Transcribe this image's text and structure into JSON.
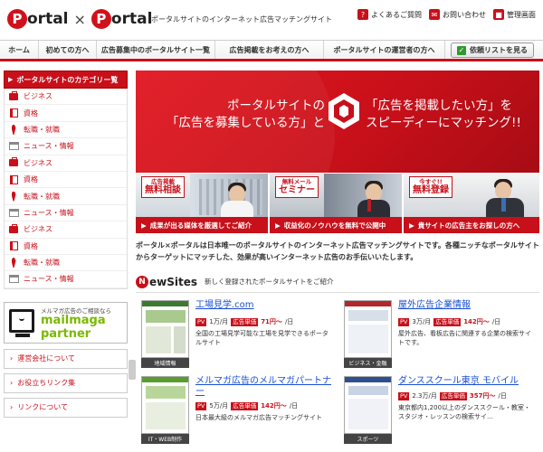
{
  "header": {
    "logo_left": "ortal",
    "logo_x": "×",
    "logo_right": "ortal",
    "logo_letter": "P",
    "tagline": "ポータルサイトのインターネット広告マッチングサイト",
    "links": [
      {
        "icon": "question-icon",
        "label": "よくあるご質問"
      },
      {
        "icon": "mail-icon",
        "label": "お問い合わせ"
      },
      {
        "icon": "lock-icon",
        "label": "管理画面"
      }
    ]
  },
  "nav": {
    "items": [
      "ホーム",
      "初めての方へ",
      "広告募集中のポータルサイト一覧",
      "広告掲載をお考えの方へ",
      "ポータルサイトの運営者の方へ"
    ],
    "list_button": "依頼リストを見る"
  },
  "sidebar": {
    "category_title": "ポータルサイトのカテゴリー覧",
    "categories": [
      {
        "icon": "briefcase-icon",
        "label": "ビジネス"
      },
      {
        "icon": "book-icon",
        "label": "資格"
      },
      {
        "icon": "tie-icon",
        "label": "転職・就職"
      },
      {
        "icon": "newspaper-icon",
        "label": "ニュース・情報"
      },
      {
        "icon": "briefcase-icon",
        "label": "ビジネス"
      },
      {
        "icon": "book-icon",
        "label": "資格"
      },
      {
        "icon": "tie-icon",
        "label": "転職・就職"
      },
      {
        "icon": "newspaper-icon",
        "label": "ニュース・情報"
      },
      {
        "icon": "briefcase-icon",
        "label": "ビジネス"
      },
      {
        "icon": "book-icon",
        "label": "資格"
      },
      {
        "icon": "tie-icon",
        "label": "転職・就職"
      },
      {
        "icon": "newspaper-icon",
        "label": "ニュース・情報"
      }
    ],
    "mailmaga": {
      "small": "メルマガ広告のご相談なら",
      "word1": "mailmaga",
      "word2": "partner"
    },
    "links": [
      "運営会社について",
      "お役立ちリンク集",
      "リンクについて"
    ]
  },
  "hero": {
    "left_line1": "ポータルサイトの",
    "left_line2": "「広告を募集している方」と",
    "right_line1": "「広告を掲載したい方」を",
    "right_line2": "スピーディーにマッチング!!"
  },
  "promos": [
    {
      "tag_top": "広告掲載",
      "tag_main": "無料相談",
      "caption": "成果が出る媒体を厳選してご紹介"
    },
    {
      "tag_top": "無料メール",
      "tag_main": "セミナー",
      "caption": "収益化のノウハウを無料で公開中"
    },
    {
      "tag_top": "今すぐ!!",
      "tag_main": "無料登録",
      "caption": "貴サイトの広告主をお探しの方へ"
    }
  ],
  "intro": "ポータル×ポータルは日本唯一のポータルサイトのインターネット広告マッチングサイトです。各種ニッチなポータルサイトからターゲットにマッチした、効果が高いインターネット広告のお手伝いいたします。",
  "new_sites": {
    "logo_letter": "N",
    "logo_rest": "ewSites",
    "subtitle": "新しく登録されたポータルサイトをご紹介",
    "items": [
      {
        "title": "工場見学.com",
        "pv_label": "PV",
        "pv": "1万/月",
        "price_label": "広告単価",
        "price": "71円〜",
        "unit": "/日",
        "desc": "全国の工場見学可能な工場を見学できるポータルサイト",
        "category": "地域情報"
      },
      {
        "title": "屋外広告企業情報",
        "pv_label": "PV",
        "pv": "3万/月",
        "price_label": "広告単価",
        "price": "142円〜",
        "unit": "/日",
        "desc": "屋外広告、看板広告に関連する企業の検索サイトです。",
        "category": "ビジネス・金融"
      },
      {
        "title": "メルマガ広告のメルマガパートナー",
        "pv_label": "PV",
        "pv": "5万/月",
        "price_label": "広告単価",
        "price": "142円〜",
        "unit": "/日",
        "desc": "日本最大級のメルマガ広告マッチングサイト",
        "category": "IT・WEB制作"
      },
      {
        "title": "ダンススクール東京 モバイル",
        "pv_label": "PV",
        "pv": "2.3万/月",
        "price_label": "広告単価",
        "price": "357円〜",
        "unit": "/日",
        "desc": "東京都内1,200以上のダンススクール・教室・スタジオ・レッスンの検索サイ…",
        "category": "スポーツ"
      }
    ]
  },
  "colors": {
    "accent": "#c8101a",
    "link": "#1a4fd6",
    "green": "#7ab800"
  }
}
